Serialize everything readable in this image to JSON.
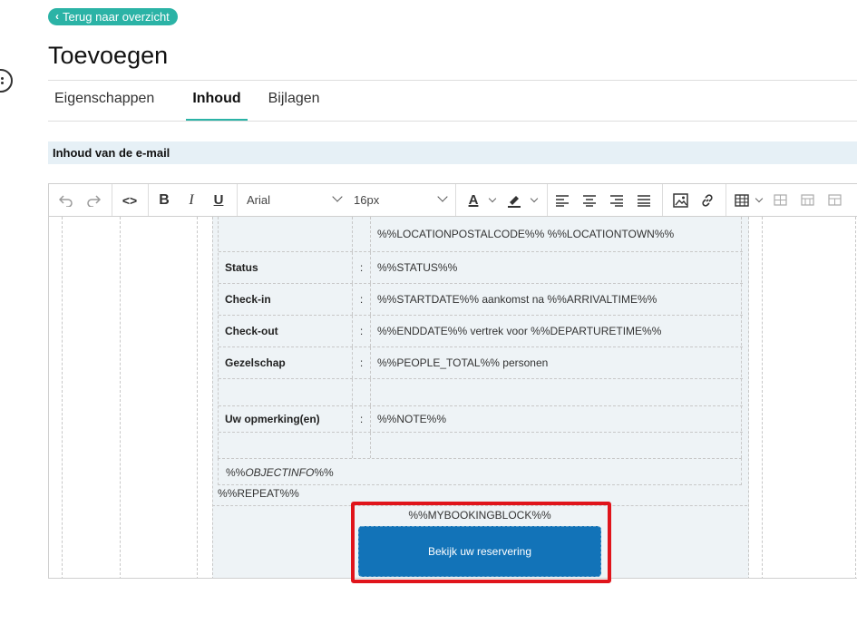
{
  "nav": {
    "back_label": "Terug naar overzicht"
  },
  "page": {
    "title": "Toevoegen"
  },
  "tabs": [
    {
      "label": "Eigenschappen",
      "active": false
    },
    {
      "label": "Inhoud",
      "active": true
    },
    {
      "label": "Bijlagen",
      "active": false
    }
  ],
  "section": {
    "title": "Inhoud van de e-mail"
  },
  "toolbar": {
    "font_family": "Arial",
    "font_size": "16px",
    "code_label": "<>",
    "bold_label": "B",
    "italic_label": "I",
    "underline_label": "U",
    "font_color_label": "A"
  },
  "template": {
    "rows": [
      {
        "label": "",
        "sep": "",
        "value": "%%LOCATIONPOSTALCODE%% %%LOCATIONTOWN%%"
      },
      {
        "label": "Status",
        "sep": ":",
        "value": "%%STATUS%%"
      },
      {
        "label": "Check-in",
        "sep": ":",
        "value": "%%STARTDATE%% aankomst na %%ARRIVALTIME%%"
      },
      {
        "label": "Check-out",
        "sep": ":",
        "value": "%%ENDDATE%% vertrek voor %%DEPARTURETIME%%"
      },
      {
        "label": "Gezelschap",
        "sep": ":",
        "value": "%%PEOPLE_TOTAL%% personen"
      },
      {
        "label": "",
        "sep": "",
        "value": ""
      },
      {
        "label": "Uw opmerking(en)",
        "sep": ":",
        "value": "%%NOTE%%"
      },
      {
        "label": "",
        "sep": "",
        "value": ""
      }
    ],
    "object_info_prefix": "%%",
    "object_info_name": "OBJECTINFO",
    "object_info_suffix": "%%",
    "repeat": "%%REPEAT%%",
    "booking_block": "%%MYBOOKINGBLOCK%%",
    "cta_label": "Bekijk uw reservering"
  },
  "colors": {
    "accent": "#2bb3a6",
    "button": "#1273b8",
    "highlight": "#e0141b",
    "section_bg": "#e6f0f6"
  }
}
